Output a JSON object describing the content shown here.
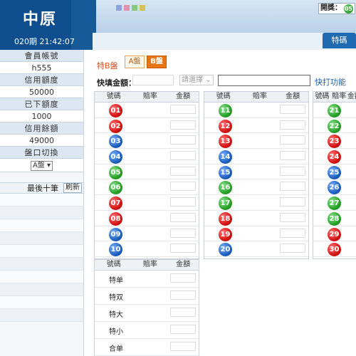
{
  "header": {
    "brand": "中原",
    "period": "020期 21:42:07",
    "kai_label": "開獎：",
    "kai_ball": "05",
    "active_tab": "特碼"
  },
  "sidebar": {
    "account_label": "會員帳號",
    "account_value": "h555",
    "credit_label": "信用額度",
    "credit_value": "50000",
    "placed_label": "已下額度",
    "placed_value": "1000",
    "balance_label": "信用餘額",
    "balance_value": "49000",
    "pan_label": "盤口切換",
    "pan_value": "A盤",
    "last10_label": "最後十筆",
    "refresh_label": "刷新"
  },
  "main": {
    "title": "特B盤",
    "tab_a": "A盤",
    "tab_b": "B盤",
    "quick_label": "快填金額：",
    "quick_select": "請選擇",
    "quick_fn": "快打功能",
    "col_num": "號碼",
    "col_odds": "賠率",
    "col_amt": "金額"
  },
  "balls": [
    {
      "n": "01",
      "c": "red"
    },
    {
      "n": "02",
      "c": "red"
    },
    {
      "n": "03",
      "c": "blue"
    },
    {
      "n": "04",
      "c": "blue"
    },
    {
      "n": "05",
      "c": "green"
    },
    {
      "n": "06",
      "c": "green"
    },
    {
      "n": "07",
      "c": "red"
    },
    {
      "n": "08",
      "c": "red"
    },
    {
      "n": "09",
      "c": "blue"
    },
    {
      "n": "10",
      "c": "blue"
    },
    {
      "n": "11",
      "c": "green"
    },
    {
      "n": "12",
      "c": "red"
    },
    {
      "n": "13",
      "c": "red"
    },
    {
      "n": "14",
      "c": "blue"
    },
    {
      "n": "15",
      "c": "blue"
    },
    {
      "n": "16",
      "c": "green"
    },
    {
      "n": "17",
      "c": "green"
    },
    {
      "n": "18",
      "c": "red"
    },
    {
      "n": "19",
      "c": "red"
    },
    {
      "n": "20",
      "c": "blue"
    },
    {
      "n": "21",
      "c": "green"
    },
    {
      "n": "22",
      "c": "green"
    },
    {
      "n": "23",
      "c": "red"
    },
    {
      "n": "24",
      "c": "red"
    },
    {
      "n": "25",
      "c": "blue"
    },
    {
      "n": "26",
      "c": "blue"
    },
    {
      "n": "27",
      "c": "green"
    },
    {
      "n": "28",
      "c": "green"
    },
    {
      "n": "29",
      "c": "red"
    },
    {
      "n": "30",
      "c": "red"
    }
  ],
  "special": [
    "特单",
    "特双",
    "特大",
    "特小",
    "合单"
  ],
  "colors": {
    "red": "#d41212",
    "blue": "#1d60c0",
    "green": "#27a127",
    "accent": "#e87511"
  }
}
